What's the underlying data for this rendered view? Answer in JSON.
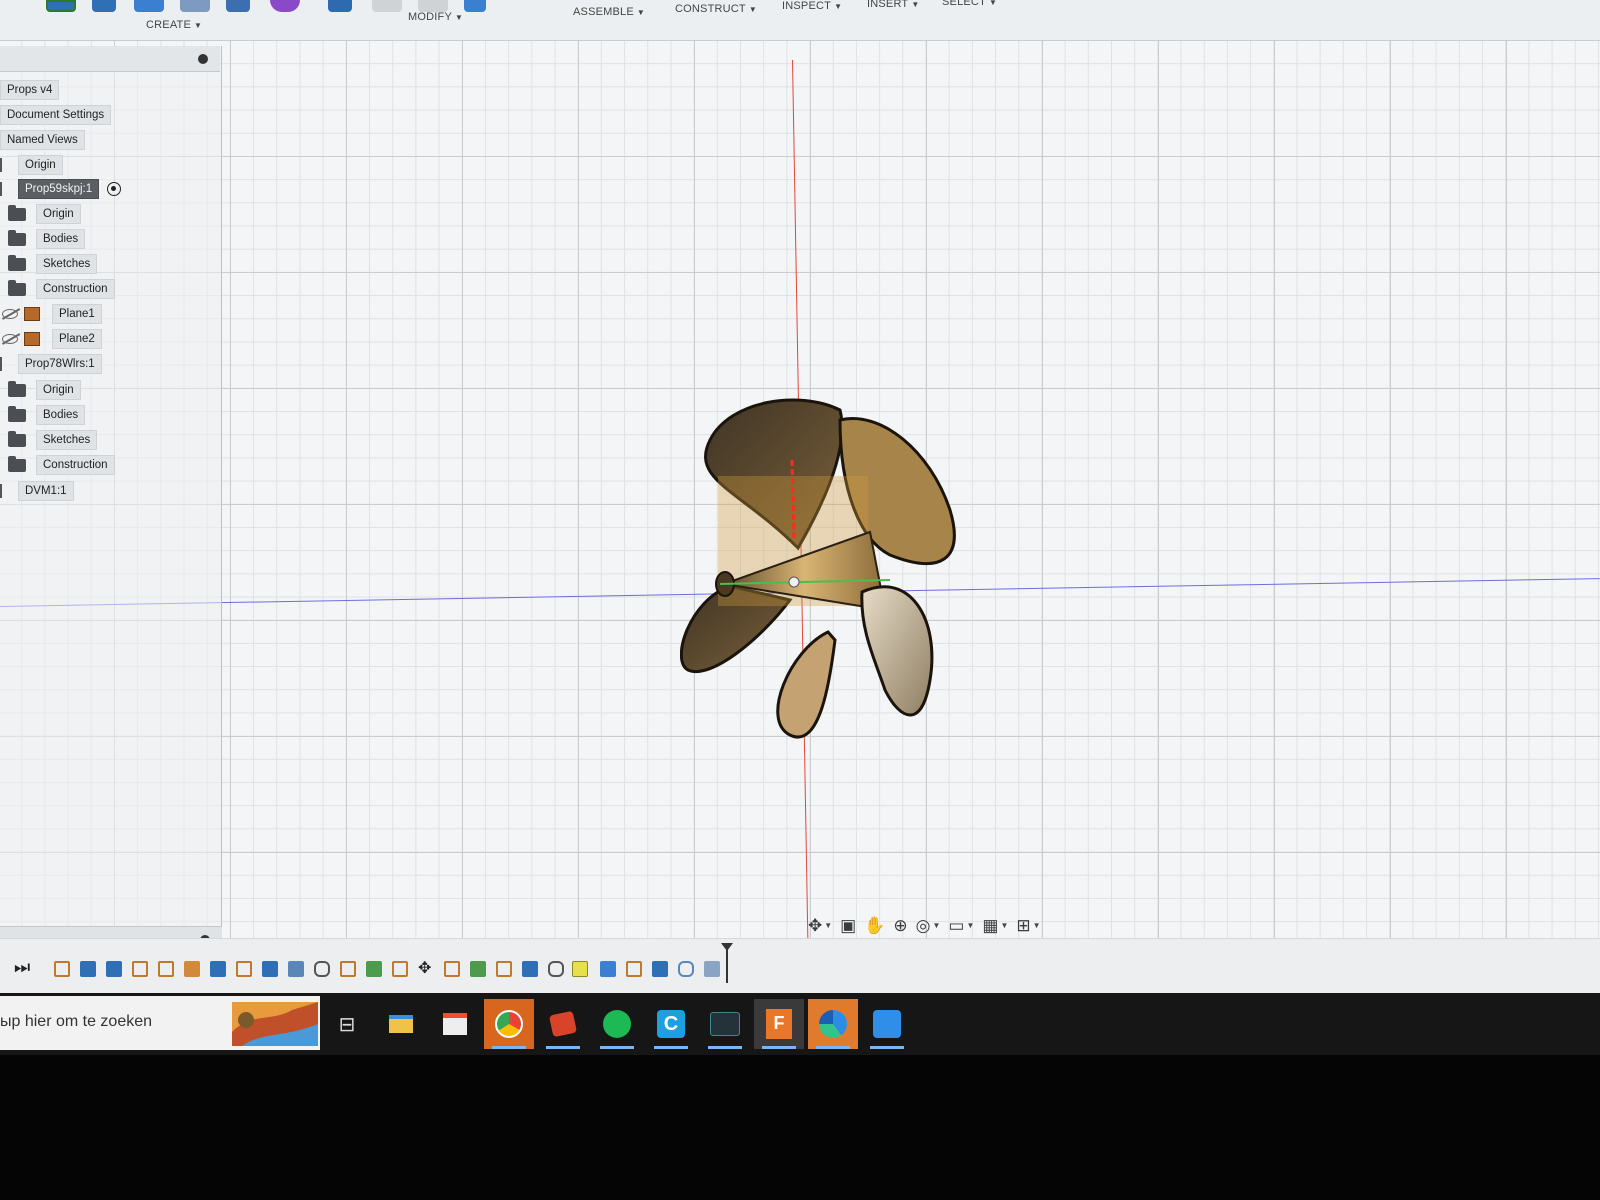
{
  "ribbon": {
    "groups": [
      "CREATE",
      "MODIFY",
      "ASSEMBLE",
      "CONSTRUCT",
      "INSPECT",
      "INSERT",
      "SELECT"
    ]
  },
  "browser": {
    "items": [
      {
        "label": "Props v4"
      },
      {
        "label": "Document Settings"
      },
      {
        "label": "Named Views"
      },
      {
        "label": "Origin"
      },
      {
        "label": "Prop59skpj:1"
      },
      {
        "label": "Origin"
      },
      {
        "label": "Bodies"
      },
      {
        "label": "Sketches"
      },
      {
        "label": "Construction"
      },
      {
        "label": "Plane1"
      },
      {
        "label": "Plane2"
      },
      {
        "label": "Prop78Wlrs:1"
      },
      {
        "label": "Origin"
      },
      {
        "label": "Bodies"
      },
      {
        "label": "Sketches"
      },
      {
        "label": "Construction"
      },
      {
        "label": "DVM1:1"
      }
    ]
  },
  "navbar": {
    "icons": [
      "orbit-icon",
      "look-at-icon",
      "pan-icon",
      "zoom-icon",
      "zoom-window-icon",
      "display-settings-icon",
      "grid-icon",
      "viewports-icon"
    ]
  },
  "taskbar": {
    "search_placeholder": "ыp hier om te zoeken",
    "apps": [
      "task-view",
      "file-explorer",
      "store",
      "chrome",
      "app-red",
      "spotify",
      "app-c",
      "app-dark",
      "fusion-360",
      "edge",
      "app-blue"
    ]
  },
  "colors": {
    "canvas": "#f3f5f6",
    "accent_selection": "#5b5f63",
    "axis_red": "#e4463a",
    "axis_blue": "#6d6de0",
    "prop_body": "#b8924f",
    "taskbar": "#161616"
  }
}
